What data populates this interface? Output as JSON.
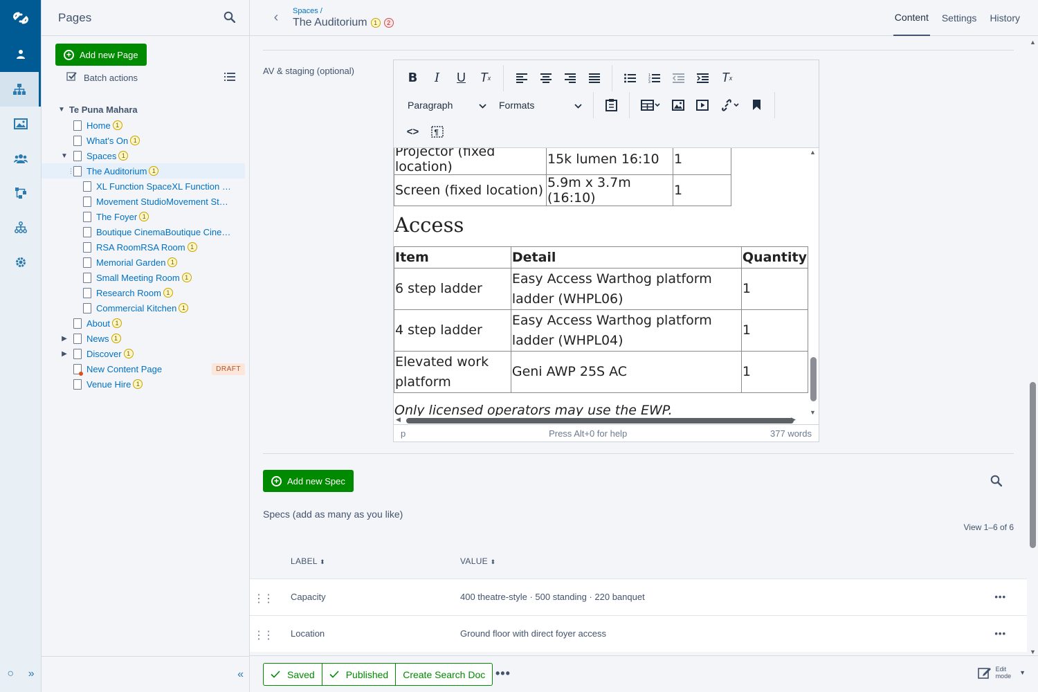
{
  "tree": {
    "title": "Pages",
    "add_button": "Add new Page",
    "batch_actions": "Batch actions",
    "root": "Te Puna Mahara",
    "items": [
      {
        "label": "Home",
        "badge": "1",
        "level": 1,
        "toggle": ""
      },
      {
        "label": "What's On",
        "badge": "1",
        "level": 1,
        "toggle": ""
      },
      {
        "label": "Spaces",
        "badge": "1",
        "level": 1,
        "toggle": "▼"
      },
      {
        "label": "The Auditorium",
        "badge": "1",
        "level": 2,
        "toggle": "",
        "selected": true
      },
      {
        "label": "XL Function SpaceXL Function Space",
        "badge": "",
        "level": 2,
        "toggle": ""
      },
      {
        "label": "Movement StudioMovement Studio",
        "badge": "",
        "level": 2,
        "toggle": ""
      },
      {
        "label": "The Foyer",
        "badge": "1",
        "level": 2,
        "toggle": ""
      },
      {
        "label": "Boutique CinemaBoutique Cinema",
        "badge": "",
        "level": 2,
        "toggle": ""
      },
      {
        "label": "RSA RoomRSA Room",
        "badge": "1",
        "level": 2,
        "toggle": ""
      },
      {
        "label": "Memorial Garden",
        "badge": "1",
        "level": 2,
        "toggle": ""
      },
      {
        "label": "Small Meeting Room",
        "badge": "1",
        "level": 2,
        "toggle": ""
      },
      {
        "label": "Research Room",
        "badge": "1",
        "level": 2,
        "toggle": ""
      },
      {
        "label": "Commercial Kitchen",
        "badge": "1",
        "level": 2,
        "toggle": ""
      },
      {
        "label": "About",
        "badge": "1",
        "level": 1,
        "toggle": ""
      },
      {
        "label": "News",
        "badge": "1",
        "level": 1,
        "toggle": "▶"
      },
      {
        "label": "Discover",
        "badge": "1",
        "level": 1,
        "toggle": "▶"
      },
      {
        "label": "New Content Page",
        "badge": "",
        "level": 1,
        "toggle": "",
        "draft": true,
        "pill": "DRAFT"
      },
      {
        "label": "Venue Hire",
        "badge": "1",
        "level": 1,
        "toggle": ""
      }
    ]
  },
  "header": {
    "breadcrumb": "Spaces /",
    "title": "The Auditorium",
    "badge_yellow": "1",
    "badge_red": "2",
    "tabs": [
      "Content",
      "Settings",
      "History"
    ]
  },
  "editor": {
    "field_label": "AV & staging (optional)",
    "paragraph_select": "Paragraph",
    "formats_select": "Formats",
    "av_rows": [
      [
        "Projector (fixed location)",
        "15k lumen 16:10",
        "1"
      ],
      [
        "Screen (fixed location)",
        "5.9m x 3.7m (16:10)",
        "1"
      ]
    ],
    "access_heading": "Access",
    "access_headers": [
      "Item",
      "Detail",
      "Quantity"
    ],
    "access_rows": [
      [
        "6 step ladder",
        "Easy Access Warthog platform ladder (WHPL06)",
        "1"
      ],
      [
        "4 step ladder",
        "Easy Access Warthog platform ladder (WHPL04)",
        "1"
      ],
      [
        "Elevated work platform",
        "Geni AWP 25S AC",
        "1"
      ]
    ],
    "note": "Only licensed operators may use the EWP.",
    "status_path": "p",
    "status_help": "Press Alt+0 for help",
    "status_words": "377 words"
  },
  "specs": {
    "add_button": "Add new Spec",
    "help": "Specs (add as many as you like)",
    "view_count": "View 1–6 of 6",
    "col_label": "LABEL",
    "col_value": "VALUE",
    "rows": [
      {
        "label": "Capacity",
        "value": "400 theatre-style · 500 standing · 220 banquet"
      },
      {
        "label": "Location",
        "value": "Ground floor with direct foyer access"
      }
    ]
  },
  "footer": {
    "saved": "Saved",
    "published": "Published",
    "create_search_doc": "Create Search Doc",
    "edit_mode_line1": "Edit",
    "edit_mode_line2": "mode"
  },
  "colors": {
    "brand_blue": "#005a93",
    "action_green": "#008a00",
    "link_blue": "#0071c4"
  }
}
